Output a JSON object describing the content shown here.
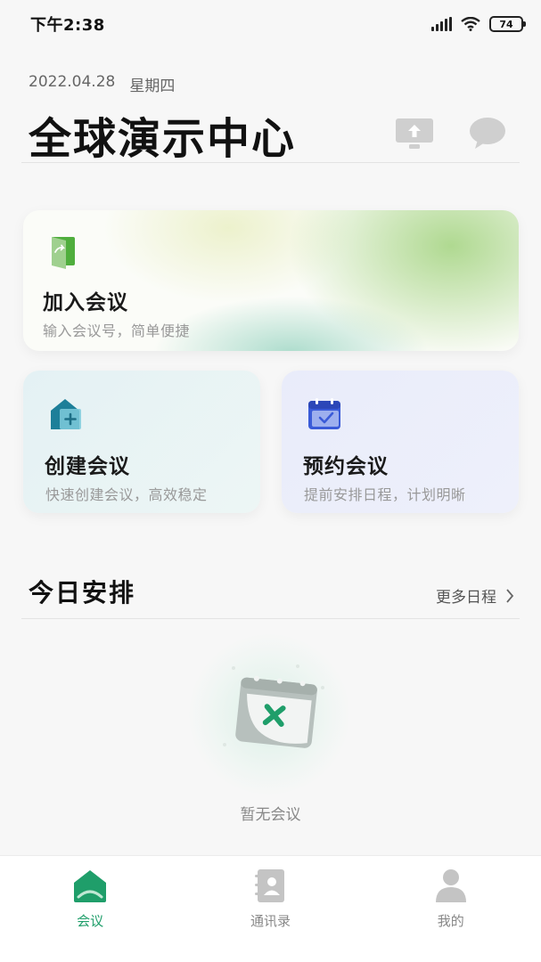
{
  "status": {
    "time": "下午2:38",
    "battery": "74"
  },
  "header": {
    "date": "2022.04.28",
    "weekday": "星期四",
    "title": "全球演示中心"
  },
  "cards": {
    "join": {
      "title": "加入会议",
      "subtitle": "输入会议号，简单便捷"
    },
    "create": {
      "title": "创建会议",
      "subtitle": "快速创建会议，高效稳定"
    },
    "schedule": {
      "title": "预约会议",
      "subtitle": "提前安排日程，计划明晰"
    }
  },
  "today": {
    "title": "今日安排",
    "more": "更多日程",
    "empty": "暂无会议"
  },
  "tabs": [
    {
      "label": "会议",
      "icon": "meeting-home-icon",
      "active": true
    },
    {
      "label": "通讯录",
      "icon": "contacts-book-icon",
      "active": false
    },
    {
      "label": "我的",
      "icon": "person-icon",
      "active": false
    }
  ],
  "colors": {
    "accent": "#1f9e6a",
    "icon_gray": "#c4c4c4"
  }
}
